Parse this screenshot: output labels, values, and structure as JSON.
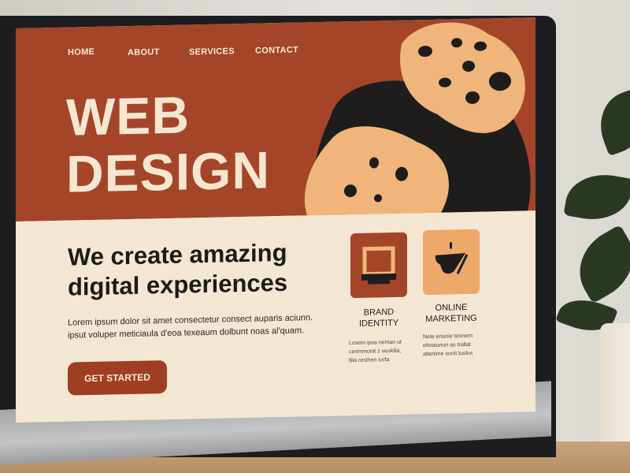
{
  "nav": {
    "items": [
      {
        "label": "HOME"
      },
      {
        "label": "ABOUT"
      },
      {
        "label": "SERVICES"
      },
      {
        "label": "CONTACT"
      }
    ]
  },
  "hero": {
    "title_line1": "WEB",
    "title_line2": "DESIGN"
  },
  "main": {
    "headline_line1": "We create amazing",
    "headline_line2": "digital experiences",
    "body_line1": "Lorem ipsum dolor sit amet consectetur consect auparis aciunn.",
    "body_line2": "ipsut voluper meticiaula d'eoa texeaum dolbunt noas al'quam.",
    "cta_label": "GET STARTED"
  },
  "features": [
    {
      "title_line1": "BRAND",
      "title_line2": "IDENTITY",
      "icon": "monitor-frame-icon",
      "desc_line1": "Losem ipsa neman ut",
      "desc_line2": "cenmmonit z vexkilia,",
      "desc_line3": "lilia resthen torfa"
    },
    {
      "title_line1": "ONLINE",
      "title_line2": "MARKETING",
      "icon": "megaphone-icon",
      "desc_line1": "Nete eriunie tonnem",
      "desc_line2": "ettvaiunun as trallat",
      "desc_line3": "altenime sonit tuslos"
    }
  ],
  "colors": {
    "hero_bg": "#a4452a",
    "cream": "#f3e7d3",
    "accent_orange": "#eda96a",
    "dark": "#1d1b19"
  }
}
